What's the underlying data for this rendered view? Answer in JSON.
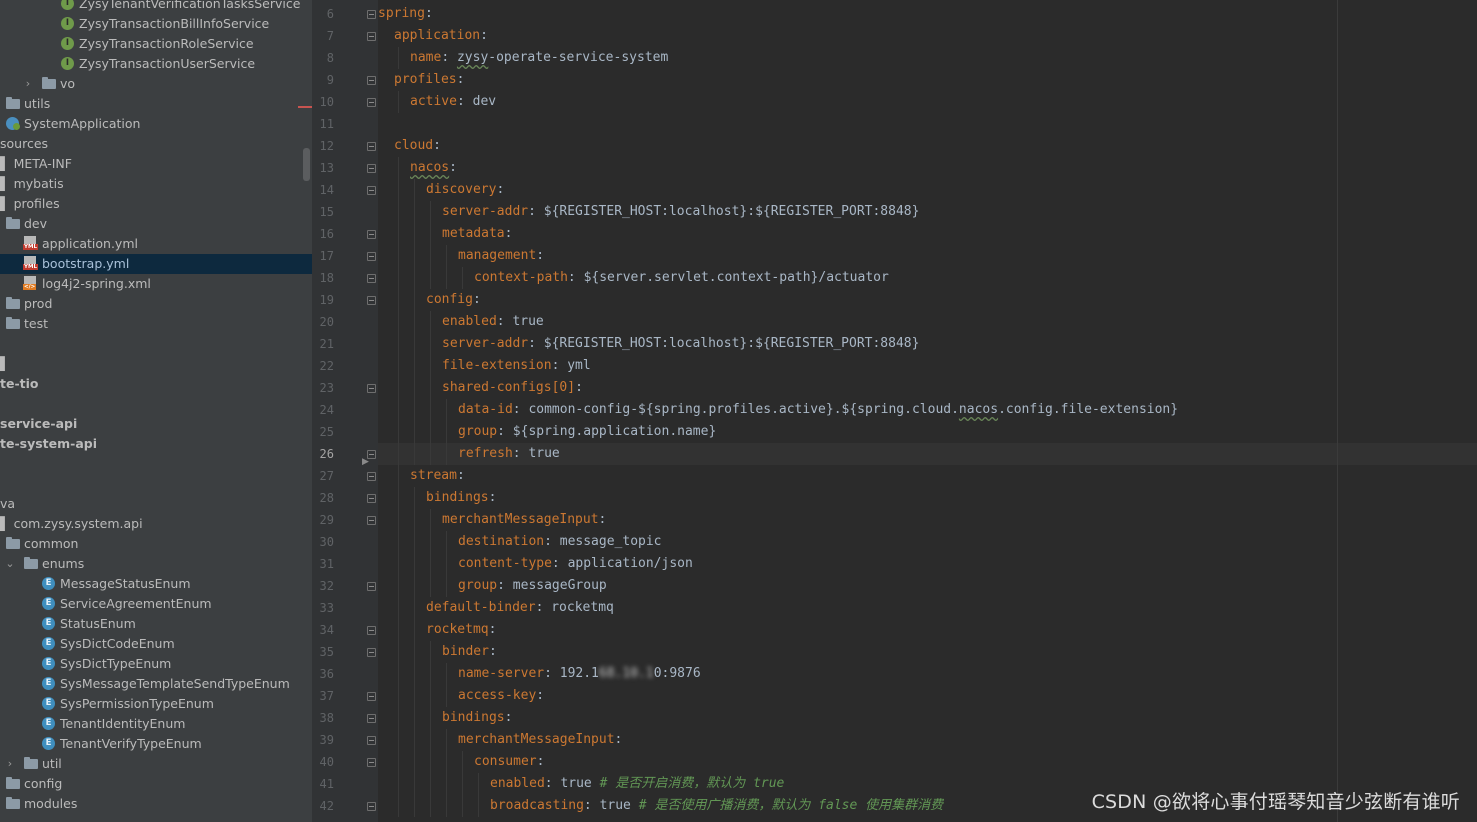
{
  "tree": {
    "rows": [
      {
        "name": "tree-row-zysy-tenant-verification-tasks-service",
        "label": "ZysyTenantVerificationTasksService",
        "icon": "interface-icon",
        "type": "i",
        "indent": 61,
        "expand": ""
      },
      {
        "name": "tree-row-zysy-transaction-bill-info-service",
        "label": "ZysyTransactionBillInfoService",
        "icon": "interface-icon",
        "type": "i",
        "indent": 61,
        "expand": ""
      },
      {
        "name": "tree-row-zysy-transaction-role-service",
        "label": "ZysyTransactionRoleService",
        "icon": "interface-icon",
        "type": "i",
        "indent": 61,
        "expand": ""
      },
      {
        "name": "tree-row-zysy-transaction-user-service",
        "label": "ZysyTransactionUserService",
        "icon": "interface-icon",
        "type": "i",
        "indent": 61,
        "expand": ""
      },
      {
        "name": "tree-row-vo",
        "label": "vo",
        "icon": "folder-icon",
        "type": "folder",
        "indent": 42,
        "expand": "›"
      },
      {
        "name": "tree-row-utils",
        "label": "utils",
        "icon": "folder-icon",
        "type": "folder",
        "indent": 6,
        "expand": ""
      },
      {
        "name": "tree-row-system-application",
        "label": "SystemApplication",
        "icon": "spring-boot-icon",
        "type": "spring",
        "indent": 6,
        "expand": ""
      },
      {
        "name": "tree-row-sources",
        "label": "sources",
        "icon": "",
        "type": "none",
        "indent": 0,
        "expand": ""
      },
      {
        "name": "tree-row-meta-inf",
        "label": "META-INF",
        "icon": "",
        "type": "none",
        "indent": 0,
        "expand": "",
        "pre": "▌ "
      },
      {
        "name": "tree-row-mybatis",
        "label": "mybatis",
        "icon": "",
        "type": "none",
        "indent": 0,
        "expand": "",
        "pre": "▌ "
      },
      {
        "name": "tree-row-profiles",
        "label": "profiles",
        "icon": "",
        "type": "none",
        "indent": 0,
        "expand": "",
        "pre": "▌ "
      },
      {
        "name": "tree-row-dev",
        "label": "dev",
        "icon": "folder-icon",
        "type": "folder",
        "indent": 6,
        "expand": ""
      },
      {
        "name": "tree-row-application-yml",
        "label": "application.yml",
        "icon": "yml-file-icon",
        "type": "yml",
        "indent": 24,
        "expand": ""
      },
      {
        "name": "tree-row-bootstrap-yml",
        "label": "bootstrap.yml",
        "icon": "yml-file-icon",
        "type": "yml",
        "indent": 24,
        "expand": "",
        "selected": true
      },
      {
        "name": "tree-row-log4j2-spring-xml",
        "label": "log4j2-spring.xml",
        "icon": "xml-file-icon",
        "type": "xml",
        "indent": 24,
        "expand": ""
      },
      {
        "name": "tree-row-prod",
        "label": "prod",
        "icon": "folder-icon",
        "type": "folder",
        "indent": 6,
        "expand": ""
      },
      {
        "name": "tree-row-test",
        "label": "test",
        "icon": "folder-icon",
        "type": "folder",
        "indent": 6,
        "expand": ""
      },
      {
        "name": "tree-row-blank-1",
        "label": "",
        "icon": "",
        "type": "none",
        "indent": 0,
        "expand": ""
      },
      {
        "name": "tree-row-edge-1",
        "label": "",
        "icon": "",
        "type": "none",
        "indent": 0,
        "expand": "",
        "pre": "▌"
      },
      {
        "name": "tree-row-te-tio",
        "label": "te-tio",
        "icon": "",
        "type": "none",
        "indent": 0,
        "expand": "",
        "bold": true
      },
      {
        "name": "tree-row-blank-2",
        "label": "",
        "icon": "",
        "type": "none",
        "indent": 0,
        "expand": ""
      },
      {
        "name": "tree-row-service-api",
        "label": "service-api",
        "icon": "",
        "type": "none",
        "indent": 0,
        "expand": "",
        "bold": true
      },
      {
        "name": "tree-row-te-system-api",
        "label": "te-system-api",
        "icon": "",
        "type": "none",
        "indent": 0,
        "expand": "",
        "bold": true
      },
      {
        "name": "tree-row-blank-3",
        "label": "",
        "icon": "",
        "type": "none",
        "indent": 0,
        "expand": ""
      },
      {
        "name": "tree-row-blank-4",
        "label": "",
        "icon": "",
        "type": "none",
        "indent": 0,
        "expand": ""
      },
      {
        "name": "tree-row-va",
        "label": "va",
        "icon": "",
        "type": "none",
        "indent": 0,
        "expand": ""
      },
      {
        "name": "tree-row-com-zysy-system-api",
        "label": "com.zysy.system.api",
        "icon": "",
        "type": "none",
        "indent": 0,
        "expand": "",
        "pre": "▌ "
      },
      {
        "name": "tree-row-common",
        "label": "common",
        "icon": "folder-icon",
        "type": "folder",
        "indent": 6,
        "expand": ""
      },
      {
        "name": "tree-row-enums",
        "label": "enums",
        "icon": "folder-icon",
        "type": "folder",
        "indent": 24,
        "expand": "⌄"
      },
      {
        "name": "tree-row-message-status-enum",
        "label": "MessageStatusEnum",
        "icon": "enum-icon",
        "type": "e",
        "indent": 42,
        "expand": ""
      },
      {
        "name": "tree-row-service-agreement-enum",
        "label": "ServiceAgreementEnum",
        "icon": "enum-icon",
        "type": "e",
        "indent": 42,
        "expand": ""
      },
      {
        "name": "tree-row-status-enum",
        "label": "StatusEnum",
        "icon": "enum-icon",
        "type": "e",
        "indent": 42,
        "expand": ""
      },
      {
        "name": "tree-row-sys-dict-code-enum",
        "label": "SysDictCodeEnum",
        "icon": "enum-icon",
        "type": "e",
        "indent": 42,
        "expand": ""
      },
      {
        "name": "tree-row-sys-dict-type-enum",
        "label": "SysDictTypeEnum",
        "icon": "enum-icon",
        "type": "e",
        "indent": 42,
        "expand": ""
      },
      {
        "name": "tree-row-sys-message-template-send-type-enum",
        "label": "SysMessageTemplateSendTypeEnum",
        "icon": "enum-icon",
        "type": "e",
        "indent": 42,
        "expand": ""
      },
      {
        "name": "tree-row-sys-permission-type-enum",
        "label": "SysPermissionTypeEnum",
        "icon": "enum-icon",
        "type": "e",
        "indent": 42,
        "expand": ""
      },
      {
        "name": "tree-row-tenant-identity-enum",
        "label": "TenantIdentityEnum",
        "icon": "enum-icon",
        "type": "e",
        "indent": 42,
        "expand": ""
      },
      {
        "name": "tree-row-tenant-verify-type-enum",
        "label": "TenantVerifyTypeEnum",
        "icon": "enum-icon",
        "type": "e",
        "indent": 42,
        "expand": ""
      },
      {
        "name": "tree-row-util",
        "label": "util",
        "icon": "folder-icon",
        "type": "folder",
        "indent": 24,
        "expand": "›"
      },
      {
        "name": "tree-row-config",
        "label": "config",
        "icon": "folder-icon",
        "type": "folder",
        "indent": 6,
        "expand": ""
      },
      {
        "name": "tree-row-modules",
        "label": "modules",
        "icon": "folder-icon",
        "type": "folder",
        "indent": 6,
        "expand": ""
      }
    ]
  },
  "editor": {
    "current_line": 26,
    "lines": [
      {
        "n": 6,
        "indent": 0,
        "key": "spring",
        "sep": ":",
        "value": "",
        "fold": true
      },
      {
        "n": 7,
        "indent": 1,
        "key": "application",
        "sep": ":",
        "value": "",
        "fold": true
      },
      {
        "n": 8,
        "indent": 2,
        "key": "name",
        "sep": ": ",
        "value": "zysy-operate-service-system",
        "fold": false,
        "squig": "zysy"
      },
      {
        "n": 9,
        "indent": 1,
        "key": "profiles",
        "sep": ":",
        "value": "",
        "fold": true
      },
      {
        "n": 10,
        "indent": 2,
        "key": "active",
        "sep": ": ",
        "value": "dev",
        "fold": true
      },
      {
        "n": 11,
        "indent": 0,
        "key": "",
        "sep": "",
        "value": "",
        "fold": false
      },
      {
        "n": 12,
        "indent": 1,
        "key": "cloud",
        "sep": ":",
        "value": "",
        "fold": true
      },
      {
        "n": 13,
        "indent": 2,
        "key": "nacos",
        "sep": ":",
        "value": "",
        "fold": true,
        "squigkey": true
      },
      {
        "n": 14,
        "indent": 3,
        "key": "discovery",
        "sep": ":",
        "value": "",
        "fold": true
      },
      {
        "n": 15,
        "indent": 4,
        "key": "server-addr",
        "sep": ": ",
        "value": "${REGISTER_HOST:localhost}:${REGISTER_PORT:8848}",
        "fold": false
      },
      {
        "n": 16,
        "indent": 4,
        "key": "metadata",
        "sep": ":",
        "value": "",
        "fold": true
      },
      {
        "n": 17,
        "indent": 5,
        "key": "management",
        "sep": ":",
        "value": "",
        "fold": true
      },
      {
        "n": 18,
        "indent": 6,
        "key": "context-path",
        "sep": ": ",
        "value": "${server.servlet.context-path}/actuator",
        "fold": true
      },
      {
        "n": 19,
        "indent": 3,
        "key": "config",
        "sep": ":",
        "value": "",
        "fold": true
      },
      {
        "n": 20,
        "indent": 4,
        "key": "enabled",
        "sep": ": ",
        "value": "true",
        "fold": false
      },
      {
        "n": 21,
        "indent": 4,
        "key": "server-addr",
        "sep": ": ",
        "value": "${REGISTER_HOST:localhost}:${REGISTER_PORT:8848}",
        "fold": false
      },
      {
        "n": 22,
        "indent": 4,
        "key": "file-extension",
        "sep": ": ",
        "value": "yml",
        "fold": false
      },
      {
        "n": 23,
        "indent": 4,
        "key": "shared-configs[0]",
        "sep": ":",
        "value": "",
        "fold": true
      },
      {
        "n": 24,
        "indent": 5,
        "key": "data-id",
        "sep": ": ",
        "value": "common-config-${spring.profiles.active}.${spring.cloud.nacos.config.file-extension}",
        "fold": false,
        "squig": "nacos"
      },
      {
        "n": 25,
        "indent": 5,
        "key": "group",
        "sep": ": ",
        "value": "${spring.application.name}",
        "fold": false
      },
      {
        "n": 26,
        "indent": 5,
        "key": "refresh",
        "sep": ": ",
        "value": "true",
        "fold": true
      },
      {
        "n": 27,
        "indent": 2,
        "key": "stream",
        "sep": ":",
        "value": "",
        "fold": true
      },
      {
        "n": 28,
        "indent": 3,
        "key": "bindings",
        "sep": ":",
        "value": "",
        "fold": true
      },
      {
        "n": 29,
        "indent": 4,
        "key": "merchantMessageInput",
        "sep": ":",
        "value": "",
        "fold": true
      },
      {
        "n": 30,
        "indent": 5,
        "key": "destination",
        "sep": ": ",
        "value": "message_topic",
        "fold": false
      },
      {
        "n": 31,
        "indent": 5,
        "key": "content-type",
        "sep": ": ",
        "value": "application/json",
        "fold": false
      },
      {
        "n": 32,
        "indent": 5,
        "key": "group",
        "sep": ": ",
        "value": "messageGroup",
        "fold": true
      },
      {
        "n": 33,
        "indent": 3,
        "key": "default-binder",
        "sep": ": ",
        "value": "rocketmq",
        "fold": false
      },
      {
        "n": 34,
        "indent": 3,
        "key": "rocketmq",
        "sep": ":",
        "value": "",
        "fold": true
      },
      {
        "n": 35,
        "indent": 4,
        "key": "binder",
        "sep": ":",
        "value": "",
        "fold": true
      },
      {
        "n": 36,
        "indent": 5,
        "key": "name-server",
        "sep": ": ",
        "value": "192.1",
        "blurred": "68.10.1",
        "value_tail": "0:9876",
        "fold": false
      },
      {
        "n": 37,
        "indent": 5,
        "key": "access-key",
        "sep": ":",
        "value": "",
        "fold": true
      },
      {
        "n": 38,
        "indent": 4,
        "key": "bindings",
        "sep": ":",
        "value": "",
        "fold": true
      },
      {
        "n": 39,
        "indent": 5,
        "key": "merchantMessageInput",
        "sep": ":",
        "value": "",
        "fold": true
      },
      {
        "n": 40,
        "indent": 6,
        "key": "consumer",
        "sep": ":",
        "value": "",
        "fold": true
      },
      {
        "n": 41,
        "indent": 7,
        "key": "enabled",
        "sep": ": ",
        "value": "true",
        "comment": " # 是否开启消费，默认为 true",
        "fold": false
      },
      {
        "n": 42,
        "indent": 7,
        "key": "broadcasting",
        "sep": ": ",
        "value": "true",
        "comment": " # 是否使用广播消费，默认为 false 使用集群消费",
        "fold": true
      }
    ]
  },
  "watermark": "CSDN @欲将心事付瑶琴知音少弦断有谁听",
  "colors": {
    "key": "#cc7832",
    "value": "#a9b7c6",
    "comment": "#629755",
    "line_number": "#606366",
    "selection": "#0d293e"
  }
}
